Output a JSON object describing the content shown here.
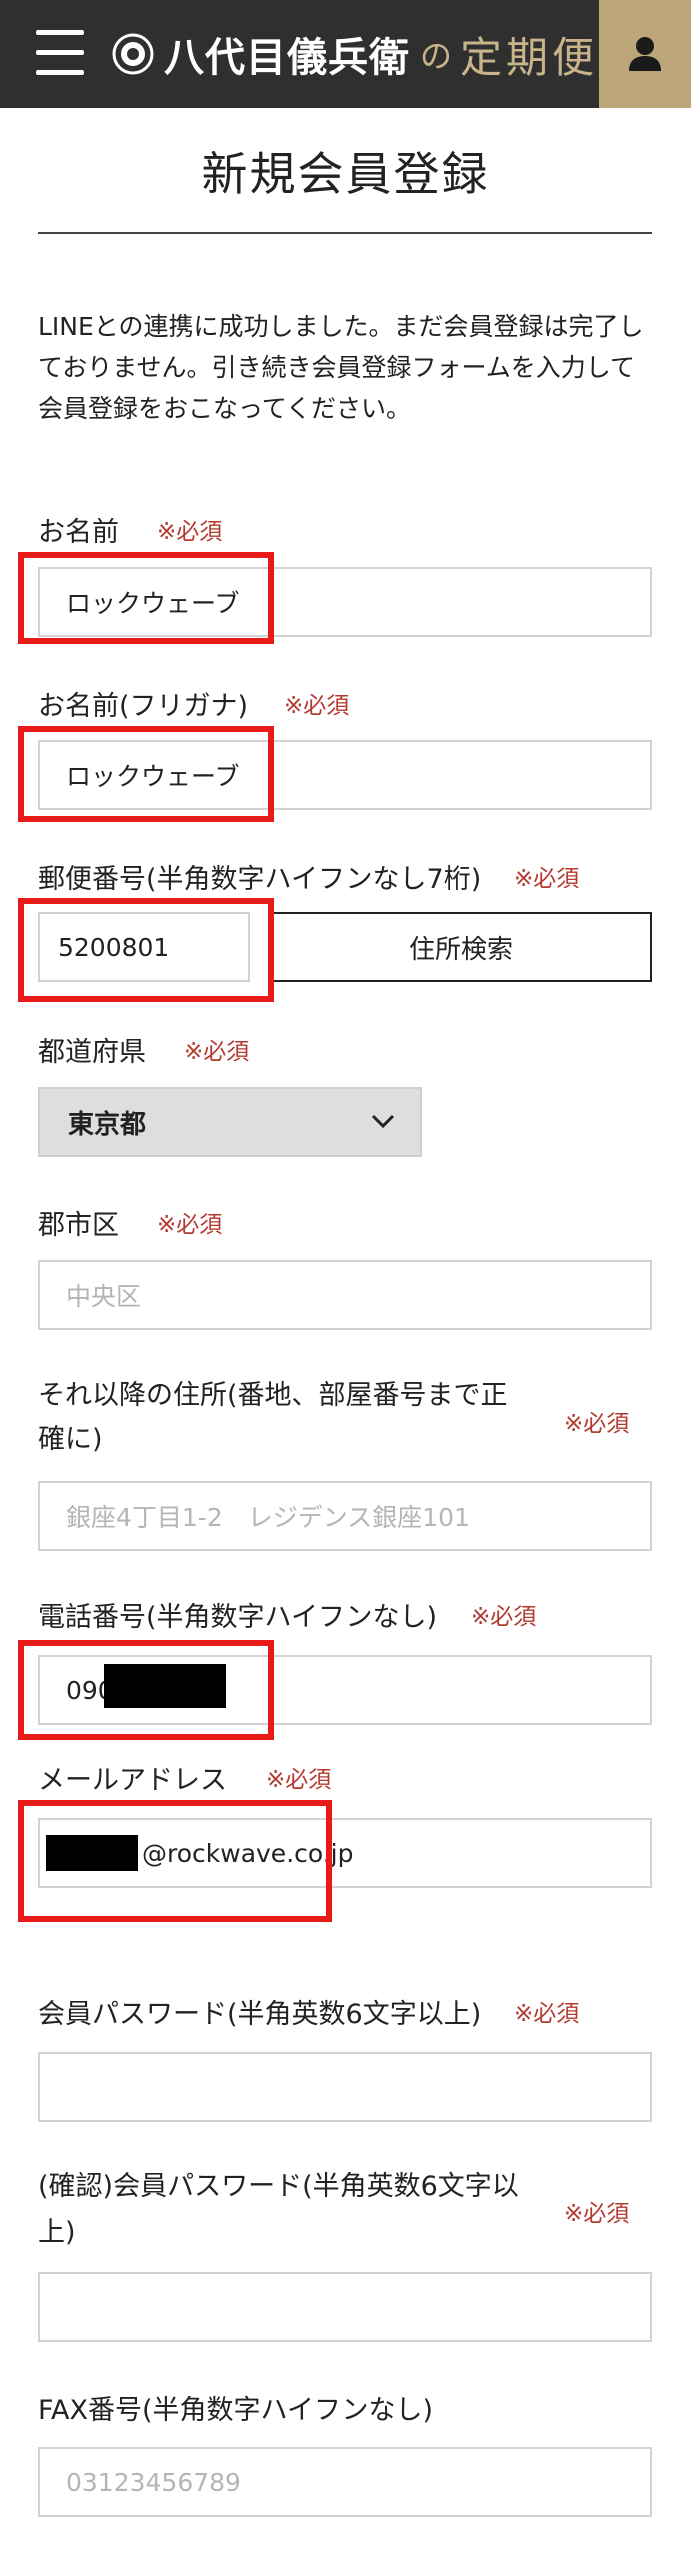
{
  "header": {
    "brand_name": "八代目儀兵衛",
    "brand_no": "の",
    "brand_teiki": "定期便"
  },
  "page": {
    "title": "新規会員登録",
    "notice_line1": "LINEとの連携に成功しました。まだ会員登録は完了し",
    "notice_line2": "ておりません。引き続き会員登録フォームを入力して",
    "notice_line3": "会員登録をおこなってください。"
  },
  "form": {
    "required_mark": "※必須",
    "name": {
      "label": "お名前",
      "value": "ロックウェーブ"
    },
    "name_kana": {
      "label": "お名前(フリガナ)",
      "value": "ロックウェーブ"
    },
    "postal": {
      "label": "郵便番号(半角数字ハイフンなし7桁)",
      "value": "5200801",
      "search_button": "住所検索"
    },
    "prefecture": {
      "label": "都道府県",
      "selected": "東京都"
    },
    "city": {
      "label": "郡市区",
      "placeholder": "中央区"
    },
    "address": {
      "label_line1": "それ以降の住所(番地、部屋番号まで正",
      "label_line2": "確に)",
      "placeholder": "銀座4丁目1-2　レジデンス銀座101"
    },
    "phone": {
      "label": "電話番号(半角数字ハイフンなし)",
      "value_visible": "090"
    },
    "email": {
      "label": "メールアドレス",
      "value_visible": "@rockwave.co.jp"
    },
    "password": {
      "label": "会員パスワード(半角英数6文字以上)"
    },
    "password_confirm": {
      "label_line1": "(確認)会員パスワード(半角英数6文字以",
      "label_line2": "上)"
    },
    "fax": {
      "label": "FAX番号(半角数字ハイフンなし)",
      "placeholder": "03123456789"
    }
  },
  "colors": {
    "header_bg": "#2f2f2f",
    "gold": "#bda77a",
    "required_red": "#b33a2e",
    "highlight_red": "#e81a1a"
  }
}
